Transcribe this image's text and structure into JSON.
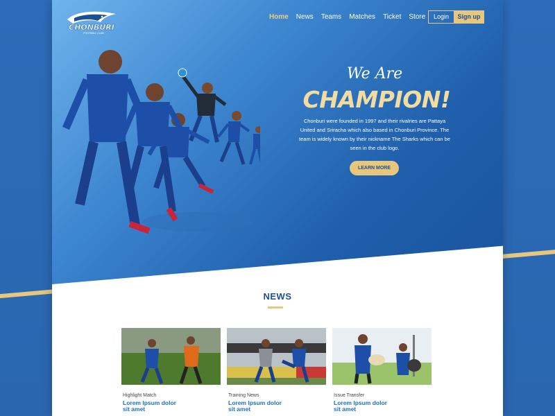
{
  "nav": {
    "items": [
      {
        "label": "Home",
        "active": true
      },
      {
        "label": "News",
        "active": false
      },
      {
        "label": "Teams",
        "active": false
      },
      {
        "label": "Matches",
        "active": false
      },
      {
        "label": "Ticket",
        "active": false
      },
      {
        "label": "Store",
        "active": false
      }
    ],
    "login_label": "Login",
    "signup_label": "Sign up"
  },
  "logo": {
    "text": "CHONBURI",
    "subtext": "FOOTBALL CLUB"
  },
  "hero": {
    "tagline": "We Are",
    "headline": "CHAMPION!",
    "description": "Chonburi were founded in 1997 and their rivalries are Pattaya United and Sriracha which also based in Chonburi Province. The team is widely known by their nickname The Sharks which can be seen in the club logo.",
    "cta_label": "LEARN MORE"
  },
  "news": {
    "title": "NEWS",
    "cards": [
      {
        "category": "Highlight Match",
        "headline": "Lorem Ipsum dolor sit amet"
      },
      {
        "category": "Training News",
        "headline": "Lorem Ipsum dolor sit amet"
      },
      {
        "category": "Issue Transfer",
        "headline": "Lorem Ipsum dolor sit amet"
      }
    ]
  },
  "colors": {
    "brand_blue": "#1d4f93",
    "gold": "#e6c77d",
    "link_blue": "#1d6fc9"
  }
}
